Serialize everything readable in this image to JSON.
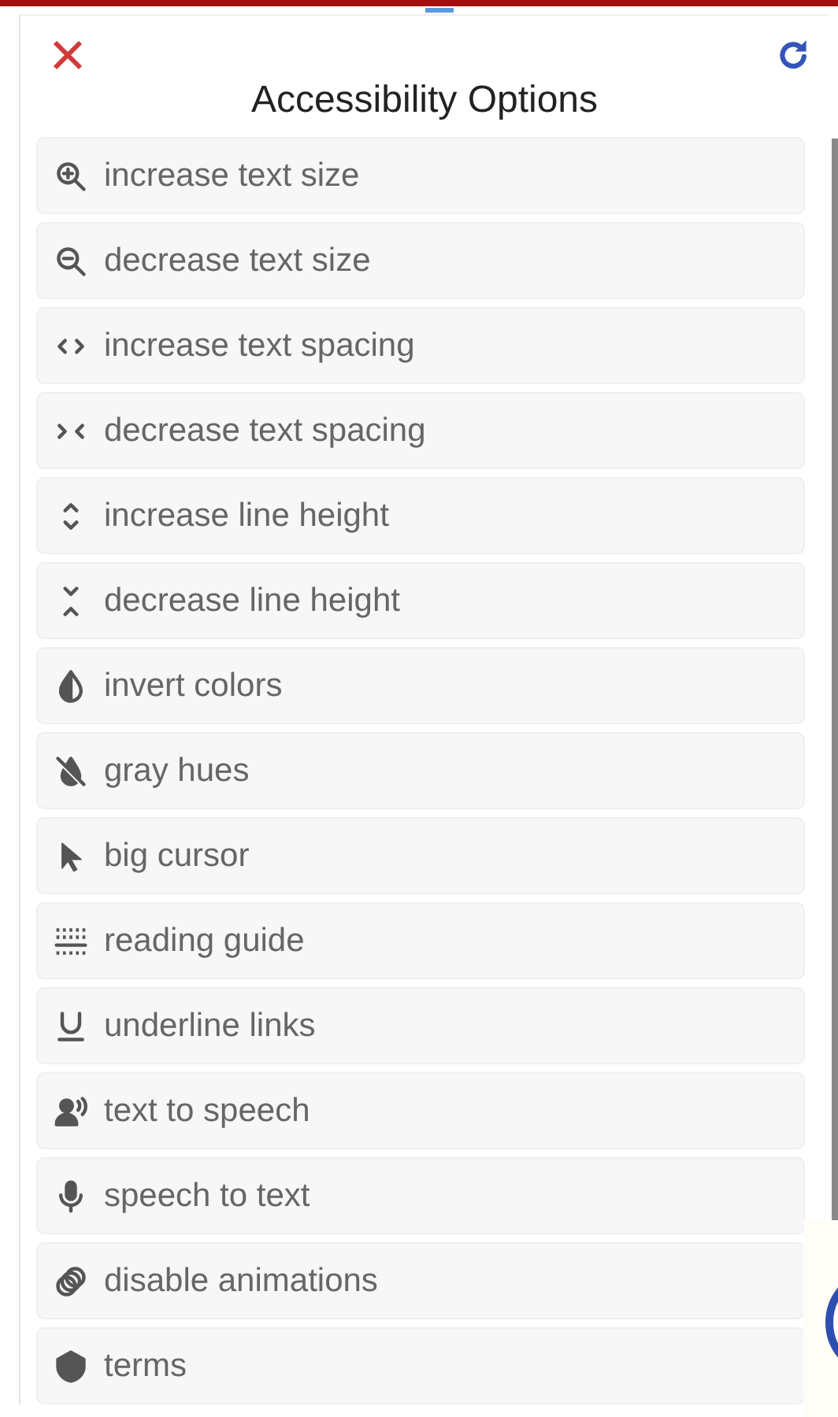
{
  "panel": {
    "title": "Accessibility Options"
  },
  "options": [
    {
      "label": "increase text size"
    },
    {
      "label": "decrease text size"
    },
    {
      "label": "increase text spacing"
    },
    {
      "label": "decrease text spacing"
    },
    {
      "label": "increase line height"
    },
    {
      "label": "decrease line height"
    },
    {
      "label": "invert colors"
    },
    {
      "label": "gray hues"
    },
    {
      "label": "big cursor"
    },
    {
      "label": "reading guide"
    },
    {
      "label": "underline links"
    },
    {
      "label": "text to speech"
    },
    {
      "label": "speech to text"
    },
    {
      "label": "disable animations"
    },
    {
      "label": "terms"
    }
  ]
}
